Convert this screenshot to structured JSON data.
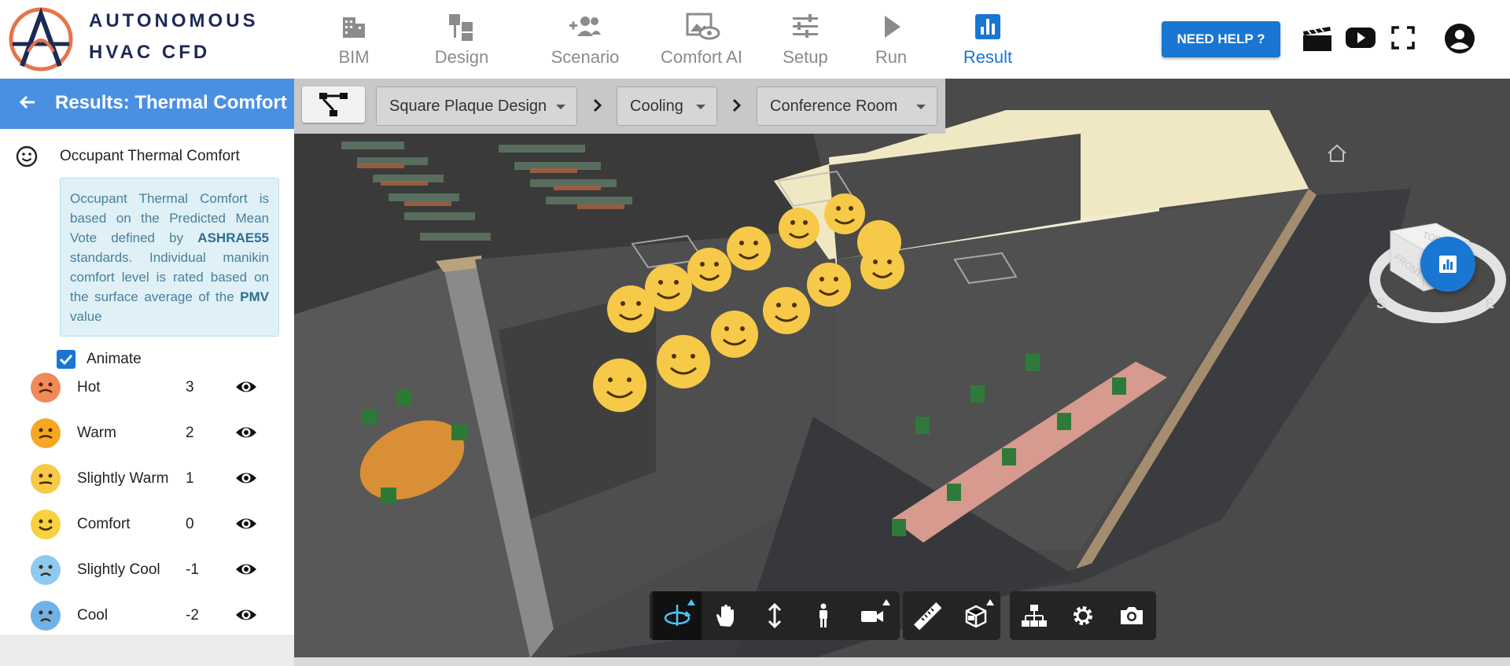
{
  "brand": {
    "line1": "AUTONOMOUS",
    "line2": "HVAC CFD"
  },
  "nav": {
    "items": [
      {
        "label": "BIM",
        "icon": "building-icon"
      },
      {
        "label": "Design",
        "icon": "design-icon"
      },
      {
        "label": "Scenario",
        "icon": "people-add-icon"
      },
      {
        "label": "Comfort AI",
        "icon": "eye-image-icon"
      },
      {
        "label": "Setup",
        "icon": "sliders-icon"
      },
      {
        "label": "Run",
        "icon": "play-icon"
      },
      {
        "label": "Result",
        "icon": "bar-chart-icon"
      }
    ],
    "active": "Result"
  },
  "header_actions": {
    "need_help": "NEED HELP ?"
  },
  "panel": {
    "title": "Results: Thermal Comfort",
    "section": "Occupant Thermal Comfort",
    "info": {
      "p1": "Occupant Thermal Comfort is based on the Predicted Mean Vote defined by ",
      "b1": "ASHRAE55",
      "p2": " standards. Individual manikin comfort level is rated based on the surface average of the ",
      "b2": "PMV",
      "p3": " value"
    },
    "animate_label": "Animate",
    "animate_checked": true,
    "levels": [
      {
        "name": "Hot",
        "value": "3",
        "color": "#f08a5a"
      },
      {
        "name": "Warm",
        "value": "2",
        "color": "#f5a623"
      },
      {
        "name": "Slightly Warm",
        "value": "1",
        "color": "#f7c948"
      },
      {
        "name": "Comfort",
        "value": "0",
        "color": "#f7d23e"
      },
      {
        "name": "Slightly Cool",
        "value": "-1",
        "color": "#8ec9f0"
      },
      {
        "name": "Cool",
        "value": "-2",
        "color": "#6fb2e8"
      }
    ]
  },
  "breadcrumb": {
    "design": "Square Plaque Design",
    "scenario": "Cooling",
    "room": "Conference Room"
  },
  "colors": {
    "accent": "#1976d2",
    "panel_header": "#4a90e2",
    "info_bg": "#dff0f7"
  },
  "toolbar": {
    "groups": [
      [
        "orbit-icon",
        "pan-hand-icon",
        "zoom-vertical-icon",
        "walk-person-icon",
        "camera-video-icon"
      ],
      [
        "measure-ruler-icon",
        "section-box-icon"
      ],
      [
        "model-tree-icon",
        "settings-gear-icon",
        "screenshot-camera-icon"
      ]
    ]
  }
}
